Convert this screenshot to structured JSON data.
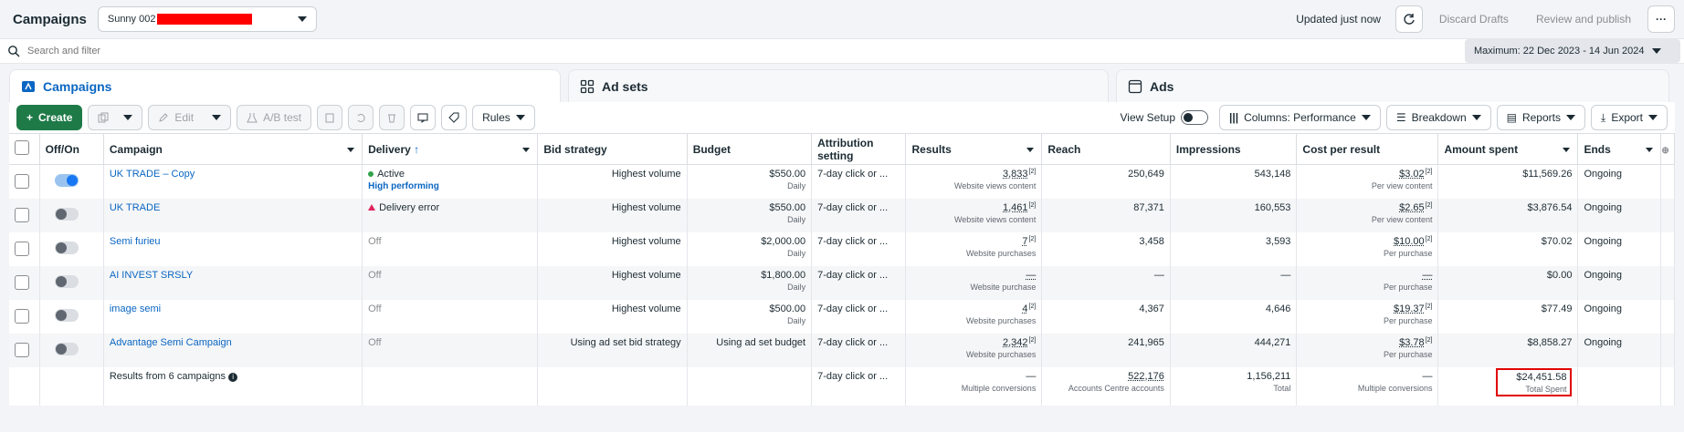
{
  "header": {
    "title": "Campaigns",
    "account": "Sunny 002",
    "updated": "Updated just now",
    "discard": "Discard Drafts",
    "review": "Review and publish",
    "more": "···"
  },
  "search": {
    "placeholder": "Search and filter",
    "date_range": "Maximum: 22 Dec 2023 - 14 Jun 2024"
  },
  "tabs": [
    {
      "label": "Campaigns"
    },
    {
      "label": "Ad sets"
    },
    {
      "label": "Ads"
    }
  ],
  "toolbar": {
    "create": "Create",
    "edit": "Edit",
    "abtest": "A/B test",
    "rules": "Rules",
    "view_setup": "View Setup",
    "columns": "Columns: Performance",
    "breakdown": "Breakdown",
    "reports": "Reports",
    "export": "Export"
  },
  "columns": [
    "Off/On",
    "Campaign",
    "Delivery",
    "Bid strategy",
    "Budget",
    "Attribution setting",
    "Results",
    "Reach",
    "Impressions",
    "Cost per result",
    "Amount spent",
    "Ends"
  ],
  "rows": [
    {
      "campaign": "UK TRADE – Copy",
      "delivery": "Active",
      "badge": "High performing",
      "bid": "Highest volume",
      "budget": "$550.00",
      "budget_sub": "Daily",
      "attr": "7-day click or ...",
      "results": "3,833",
      "results_sub": "Website views content",
      "reach": "250,649",
      "impr": "543,148",
      "cpr": "$3.02",
      "cpr_sub": "Per view content",
      "spent": "$11,569.26",
      "ends": "Ongoing"
    },
    {
      "campaign": "UK TRADE",
      "delivery": "Delivery error",
      "bid": "Highest volume",
      "budget": "$550.00",
      "budget_sub": "Daily",
      "attr": "7-day click or ...",
      "results": "1,461",
      "results_sub": "Website views content",
      "reach": "87,371",
      "impr": "160,553",
      "cpr": "$2.65",
      "cpr_sub": "Per view content",
      "spent": "$3,876.54",
      "ends": "Ongoing"
    },
    {
      "campaign": "Semi furieu",
      "delivery": "Off",
      "bid": "Highest volume",
      "budget": "$2,000.00",
      "budget_sub": "Daily",
      "attr": "7-day click or ...",
      "results": "7",
      "results_sub": "Website purchases",
      "reach": "3,458",
      "impr": "3,593",
      "cpr": "$10.00",
      "cpr_sub": "Per purchase",
      "spent": "$70.02",
      "ends": "Ongoing"
    },
    {
      "campaign": "AI INVEST SRSLY",
      "delivery": "Off",
      "bid": "Highest volume",
      "budget": "$1,800.00",
      "budget_sub": "Daily",
      "attr": "7-day click or ...",
      "results": "—",
      "results_sub": "Website purchase",
      "reach": "—",
      "impr": "—",
      "cpr": "—",
      "cpr_sub": "Per purchase",
      "spent": "$0.00",
      "ends": "Ongoing"
    },
    {
      "campaign": "image semi",
      "delivery": "Off",
      "bid": "Highest volume",
      "budget": "$500.00",
      "budget_sub": "Daily",
      "attr": "7-day click or ...",
      "results": "4",
      "results_sub": "Website purchases",
      "reach": "4,367",
      "impr": "4,646",
      "cpr": "$19.37",
      "cpr_sub": "Per purchase",
      "spent": "$77.49",
      "ends": "Ongoing"
    },
    {
      "campaign": "Advantage Semi Campaign",
      "delivery": "Off",
      "bid": "Using ad set bid strategy",
      "budget": "Using ad set budget",
      "budget_sub": "",
      "attr": "7-day click or ...",
      "results": "2,342",
      "results_sub": "Website purchases",
      "reach": "241,965",
      "impr": "444,271",
      "cpr": "$3.78",
      "cpr_sub": "Per purchase",
      "spent": "$8,858.27",
      "ends": "Ongoing"
    }
  ],
  "totals": {
    "label": "Results from 6 campaigns",
    "attr": "7-day click or ...",
    "results": "—",
    "results_sub": "Multiple conversions",
    "reach": "522,176",
    "reach_sub": "Accounts Centre accounts",
    "impr": "1,156,211",
    "impr_sub": "Total",
    "cpr": "—",
    "cpr_sub": "Multiple conversions",
    "spent": "$24,451.58",
    "spent_sub": "Total Spent"
  }
}
